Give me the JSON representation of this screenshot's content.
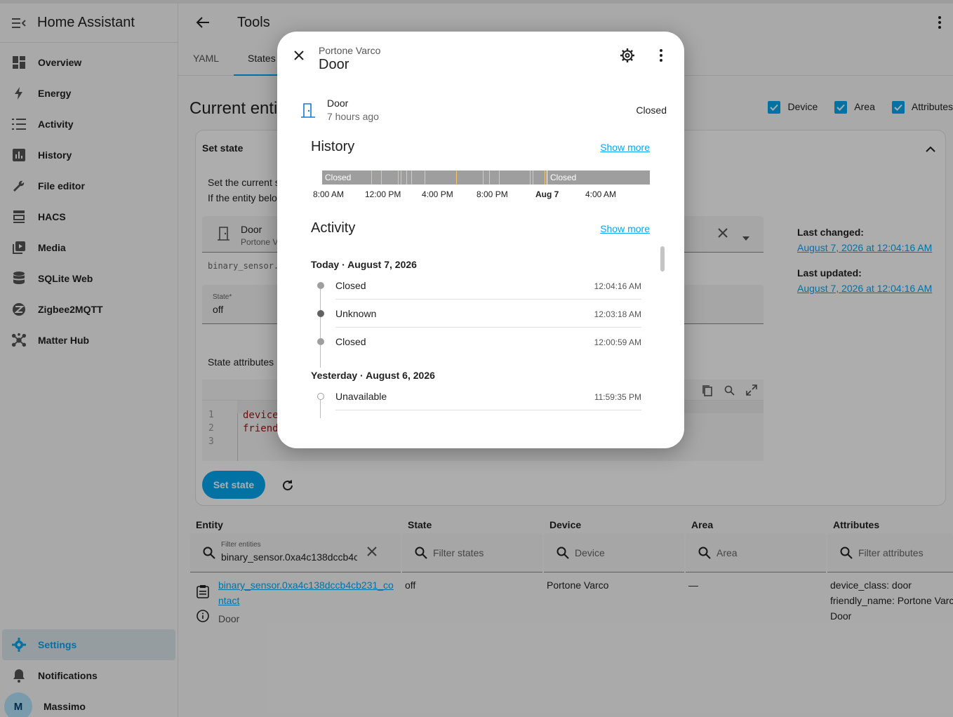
{
  "sidebar": {
    "title": "Home Assistant",
    "items": [
      {
        "label": "Overview",
        "icon": "dashboard-icon"
      },
      {
        "label": "Energy",
        "icon": "lightning-icon"
      },
      {
        "label": "Activity",
        "icon": "list-icon"
      },
      {
        "label": "History",
        "icon": "chart-icon"
      },
      {
        "label": "File editor",
        "icon": "wrench-icon"
      },
      {
        "label": "HACS",
        "icon": "hacs-icon"
      },
      {
        "label": "Media",
        "icon": "media-icon"
      },
      {
        "label": "SQLite Web",
        "icon": "database-icon"
      },
      {
        "label": "Zigbee2MQTT",
        "icon": "zigbee-icon"
      },
      {
        "label": "Matter Hub",
        "icon": "hub-icon"
      }
    ],
    "settings": "Settings",
    "notifications": "Notifications",
    "user": {
      "initial": "M",
      "name": "Massimo"
    }
  },
  "main": {
    "title": "Tools",
    "tabs": [
      "YAML",
      "States"
    ],
    "section_title": "Current enti",
    "filters": [
      "Device",
      "Area",
      "Attributes"
    ],
    "card": {
      "title": "Set state",
      "desc1": "Set the current s",
      "desc2": "If the entity belo",
      "entity_name": "Door",
      "entity_sub": "Portone V",
      "entity_id_partial": "binary_sensor.",
      "state_label": "State*",
      "state_value": "off",
      "attributes_label": "State attributes",
      "code_lines": [
        "1",
        "2",
        "3"
      ],
      "code": [
        "device",
        "friend"
      ],
      "set_state_button": "Set state",
      "last_changed_label": "Last changed:",
      "last_changed": "August 7, 2026 at 12:04:16 AM",
      "last_updated_label": "Last updated:",
      "last_updated": "August 7, 2026 at 12:04:16 AM"
    },
    "table": {
      "headers": [
        "Entity",
        "State",
        "Device",
        "Area",
        "Attributes"
      ],
      "filter_entities_label": "Filter entities",
      "filter_entities_value": "binary_sensor.0xa4c138dccb4c",
      "filter_states": "Filter states",
      "filter_device": "Device",
      "filter_area": "Area",
      "filter_attributes": "Filter attributes",
      "row": {
        "entity_line1": "binary_sensor.0xa4c138dccb4cb231_co",
        "entity_line2": "ntact",
        "friendly": "Door",
        "state": "off",
        "device": "Portone Varco",
        "area": "—",
        "attr1": "device_class: door",
        "attr2": "friendly_name: Portone Varc",
        "attr3": "Door"
      }
    }
  },
  "dialog": {
    "subtitle": "Portone Varco",
    "title": "Door",
    "entity_name": "Door",
    "entity_time": "7 hours ago",
    "entity_state": "Closed",
    "history_title": "History",
    "activity_title": "Activity",
    "show_more": "Show more",
    "timeline_label_start": "Closed",
    "timeline_label_end": "Closed",
    "ticks": [
      "8:00 AM",
      "12:00 PM",
      "4:00 PM",
      "8:00 PM",
      "Aug 7",
      "4:00 AM"
    ],
    "today": "Today · August 7, 2026",
    "yesterday": "Yesterday · August 6, 2026",
    "events": [
      {
        "state": "Closed",
        "time": "12:04:16 AM"
      },
      {
        "state": "Unknown",
        "time": "12:03:18 AM"
      },
      {
        "state": "Closed",
        "time": "12:00:59 AM"
      },
      {
        "state": "Unavailable",
        "time": "11:59:35 PM"
      }
    ]
  }
}
